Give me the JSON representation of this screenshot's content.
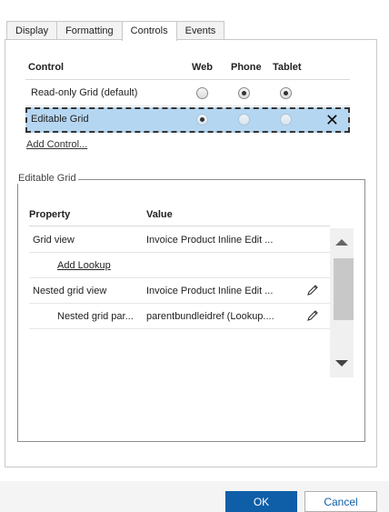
{
  "tabs": [
    {
      "label": "Display"
    },
    {
      "label": "Formatting"
    },
    {
      "label": "Controls"
    },
    {
      "label": "Events"
    }
  ],
  "active_tab": "Controls",
  "controls_table": {
    "headers": {
      "control": "Control",
      "web": "Web",
      "phone": "Phone",
      "tablet": "Tablet"
    },
    "rows": [
      {
        "name": "Read-only Grid (default)",
        "web": false,
        "phone": true,
        "tablet": true,
        "selected": false
      },
      {
        "name": "Editable Grid",
        "web": true,
        "phone": false,
        "tablet": false,
        "selected": true
      }
    ],
    "remove_icon": "close-icon",
    "selection_color": "#b5d6f1"
  },
  "add_control_label": "Add Control...",
  "editable_grid": {
    "legend": "Editable Grid",
    "headers": {
      "property": "Property",
      "value": "Value"
    },
    "rows": [
      {
        "property": "Grid view",
        "value": "Invoice Product Inline Edit ...",
        "indent": false,
        "editable": false
      },
      {
        "property": "Add Lookup",
        "value": "",
        "indent": true,
        "link": true,
        "editable": false
      },
      {
        "property": "Nested grid view",
        "value": "Invoice Product Inline Edit ...",
        "indent": false,
        "editable": true
      },
      {
        "property": "Nested grid par...",
        "value": "parentbundleidref (Lookup....",
        "indent": true,
        "editable": true
      }
    ]
  },
  "buttons": {
    "ok": "OK",
    "cancel": "Cancel"
  },
  "colors": {
    "primary": "#0f5ea8"
  }
}
